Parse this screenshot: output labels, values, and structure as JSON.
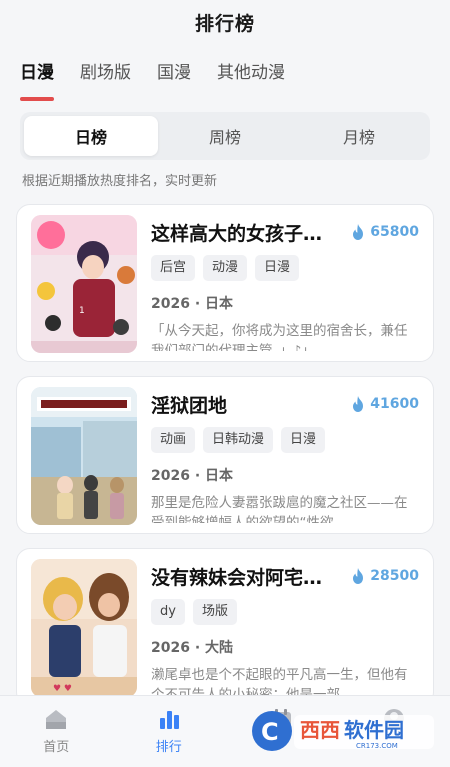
{
  "header": {
    "title": "排行榜"
  },
  "category_tabs": [
    {
      "label": "日漫",
      "active": true
    },
    {
      "label": "剧场版",
      "active": false
    },
    {
      "label": "国漫",
      "active": false
    },
    {
      "label": "其他动漫",
      "active": false
    }
  ],
  "period_tabs": [
    {
      "label": "日榜",
      "active": true
    },
    {
      "label": "周榜",
      "active": false
    },
    {
      "label": "月榜",
      "active": false
    }
  ],
  "hint": "根据近期播放热度排名，实时更新",
  "items": [
    {
      "title": "这样高大的女孩子…",
      "heat": "65800",
      "tags": [
        "后宫",
        "动漫",
        "日漫"
      ],
      "meta": "2026 · 日本",
      "desc": "「从今天起，你将成为这里的宿舍长，兼任我们部门的代理主管。」♪」"
    },
    {
      "title": "淫狱团地",
      "heat": "41600",
      "tags": [
        "动画",
        "日韩动漫",
        "日漫"
      ],
      "meta": "2026 · 日本",
      "desc": "那里是危险人妻嚣张跋扈的魔之社区——在受到能够增幅人的欲望的“性欲…"
    },
    {
      "title": "没有辣妹会对阿宅…",
      "heat": "28500",
      "tags": [
        "dy",
        "场版"
      ],
      "meta": "2026 · 大陆",
      "desc": "濑尾卓也是个不起眼的平凡高一生，但他有个不可告人的小秘密：他是一部…"
    }
  ],
  "bottom_nav": [
    {
      "label": "首页",
      "icon": "home-icon",
      "active": false
    },
    {
      "label": "排行",
      "icon": "ranking-icon",
      "active": true
    },
    {
      "label": "",
      "icon": "calendar-icon",
      "active": false
    },
    {
      "label": "",
      "icon": "profile-icon",
      "active": false
    }
  ],
  "watermark": {
    "brand": "西西软件园",
    "site": "CR173.COM"
  },
  "colors": {
    "accent_red": "#e24c4c",
    "heat_blue": "#5fa6e0",
    "nav_active": "#3b82f6"
  }
}
